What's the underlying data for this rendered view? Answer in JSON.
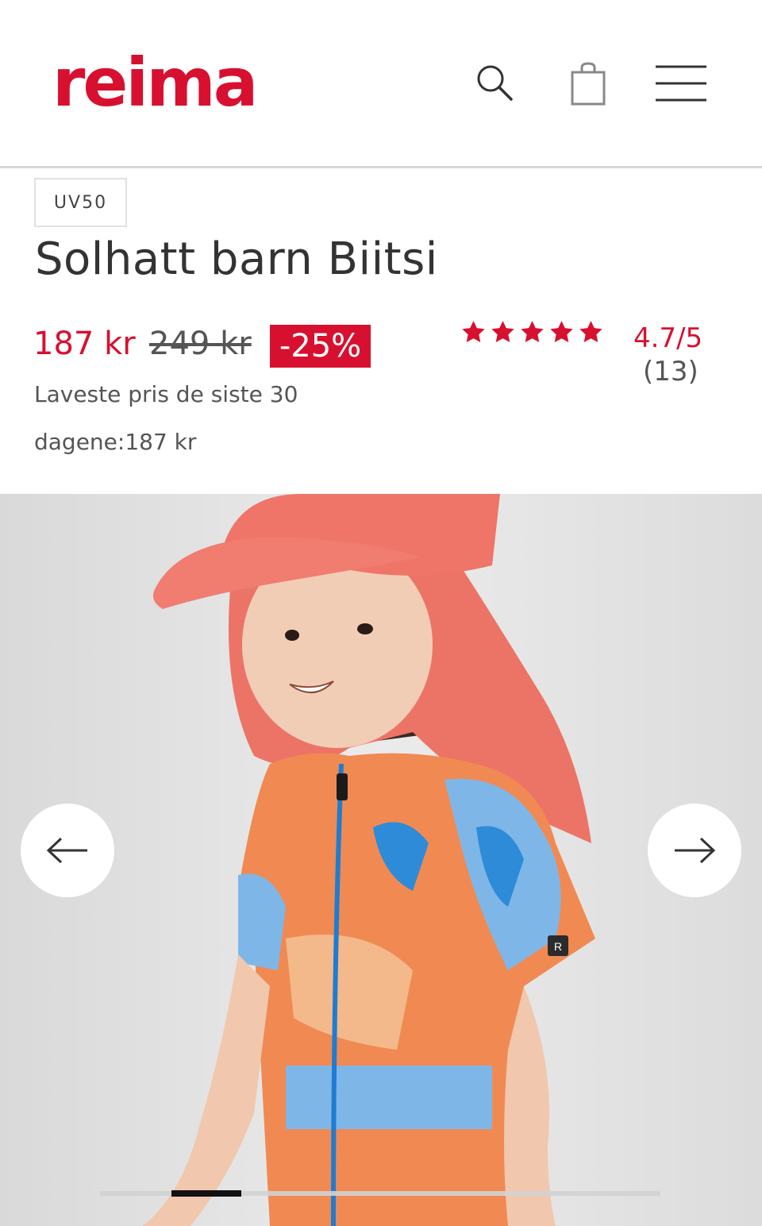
{
  "header": {
    "logo_text": "reima",
    "brand_color": "#d8102f",
    "icons": [
      "search-icon",
      "shopping-bag-icon",
      "menu-icon"
    ]
  },
  "product": {
    "badge": "UV50",
    "title": "Solhatt barn Biitsi",
    "price_now": "187 kr",
    "price_old": "249 kr",
    "discount": "-25%",
    "lowest_price_line1": "Laveste pris de siste 30",
    "lowest_price_line2": "dagene:187 kr",
    "rating": "4.7/5",
    "rating_count": "(13)",
    "stars_filled": 5
  },
  "gallery": {
    "prev_icon": "arrow-left-icon",
    "next_icon": "arrow-right-icon",
    "image_description_icon": "product-photo",
    "progress_fraction": 0.125
  },
  "colors": {
    "accent": "#d8102f",
    "text": "#333333",
    "muted": "#555555",
    "divider": "#d6d6d6"
  }
}
